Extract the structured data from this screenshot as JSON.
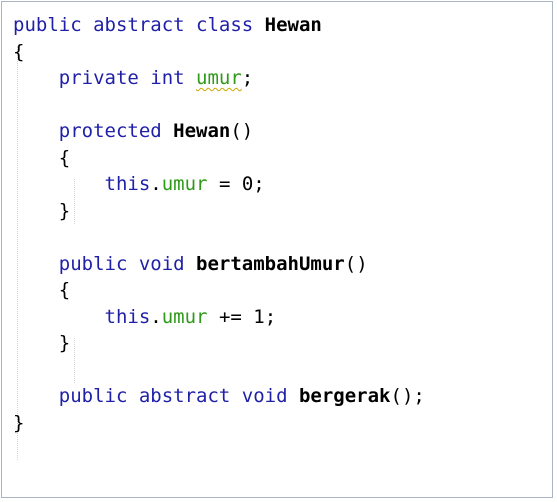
{
  "code": {
    "lines": [
      [
        {
          "t": "public abstract class ",
          "c": "kw"
        },
        {
          "t": "Hewan",
          "c": "name"
        }
      ],
      [
        {
          "t": "{",
          "c": "punct"
        }
      ],
      [
        {
          "t": "    private int ",
          "c": "kw"
        },
        {
          "t": "umur",
          "c": "field squiggle"
        },
        {
          "t": ";",
          "c": "punct"
        }
      ],
      [],
      [
        {
          "t": "    protected ",
          "c": "kw"
        },
        {
          "t": "Hewan",
          "c": "name"
        },
        {
          "t": "()",
          "c": "punct"
        }
      ],
      [
        {
          "t": "    {",
          "c": "punct"
        }
      ],
      [
        {
          "t": "        this",
          "c": "kw"
        },
        {
          "t": ".",
          "c": "punct"
        },
        {
          "t": "umur",
          "c": "field"
        },
        {
          "t": " = 0;",
          "c": "punct"
        }
      ],
      [
        {
          "t": "    }",
          "c": "punct"
        }
      ],
      [],
      [
        {
          "t": "    public void ",
          "c": "kw"
        },
        {
          "t": "bertambahUmur",
          "c": "name"
        },
        {
          "t": "()",
          "c": "punct"
        }
      ],
      [
        {
          "t": "    {",
          "c": "punct"
        }
      ],
      [
        {
          "t": "        this",
          "c": "kw"
        },
        {
          "t": ".",
          "c": "punct"
        },
        {
          "t": "umur",
          "c": "field"
        },
        {
          "t": " += 1;",
          "c": "punct"
        }
      ],
      [
        {
          "t": "    }",
          "c": "punct"
        }
      ],
      [],
      [
        {
          "t": "    public abstract void ",
          "c": "kw"
        },
        {
          "t": "bergerak",
          "c": "name"
        },
        {
          "t": "();",
          "c": "punct"
        }
      ],
      [
        {
          "t": "}",
          "c": "punct"
        }
      ]
    ]
  },
  "colors": {
    "keyword": "#1f1fa8",
    "field": "#2f9a1a",
    "text": "#000000",
    "border": "#a9b4c4"
  }
}
